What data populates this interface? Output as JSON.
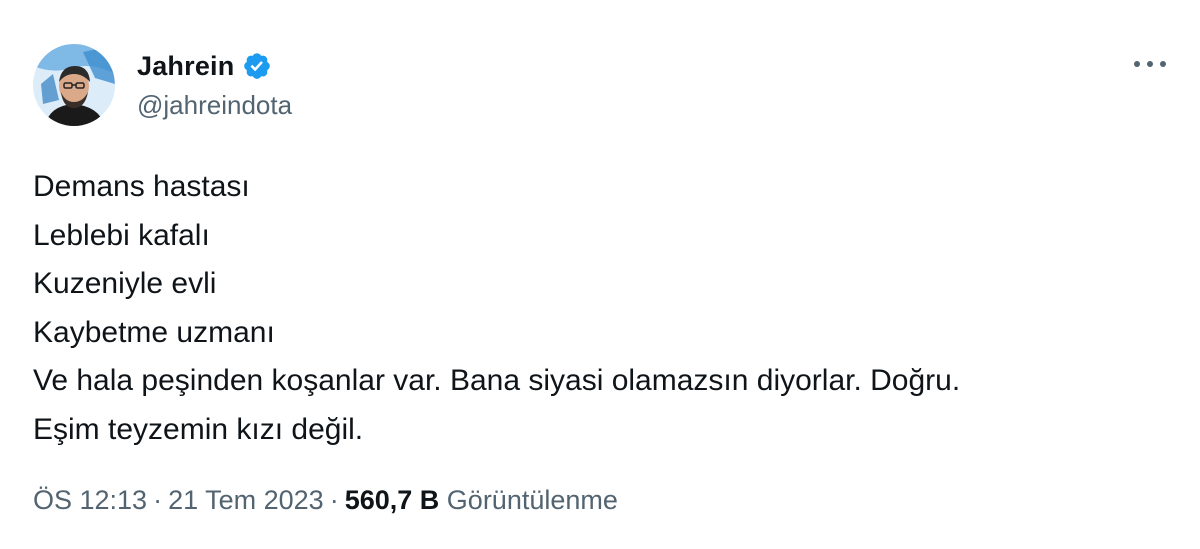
{
  "author": {
    "display_name": "Jahrein",
    "handle": "@jahreindota",
    "verified": true
  },
  "icons": {
    "verified": "verified-badge-icon",
    "more": "more-options-icon",
    "avatar": "avatar"
  },
  "colors": {
    "verified_blue": "#1d9bf0",
    "secondary_text": "#536471",
    "primary_text": "#0f1419"
  },
  "tweet": {
    "lines": [
      "Demans hastası",
      "Leblebi kafalı",
      "Kuzeniyle evli",
      "Kaybetme uzmanı",
      "Ve hala peşinden koşanlar var. Bana siyasi olamazsın diyorlar. Doğru.",
      "Eşim teyzemin kızı değil."
    ]
  },
  "meta": {
    "time": "ÖS 12:13",
    "separator": "·",
    "date": "21 Tem 2023",
    "views_count": "560,7 B",
    "views_label": "Görüntülenme"
  }
}
